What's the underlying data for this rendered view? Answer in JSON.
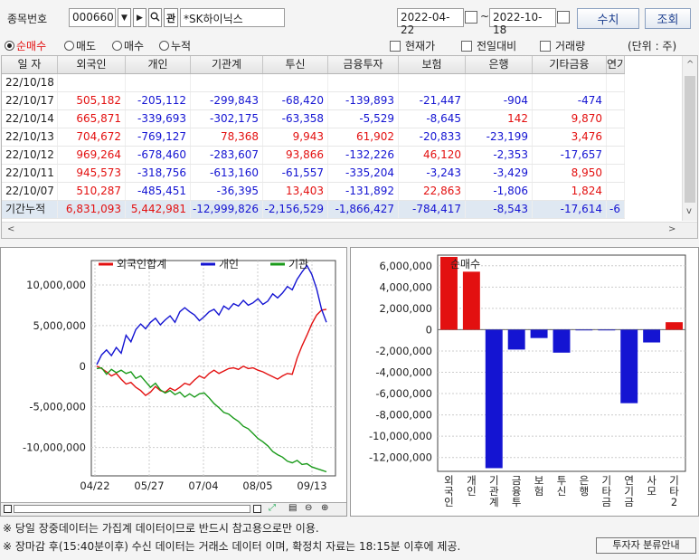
{
  "toolbar": {
    "code_label": "종목번호",
    "code_value": "000660",
    "dropdown_icon": "triangle-down",
    "next_icon": "triangle-right",
    "search_icon": "magnifier",
    "link_label": "관",
    "name_value": "*SK하이닉스",
    "start_date": "2022-04-22",
    "end_date": "2022-10-18",
    "tilde": "~",
    "chart_button": "수치",
    "query_button": "조회"
  },
  "options": {
    "radios": [
      {
        "label": "순매수",
        "selected": true
      },
      {
        "label": "매도",
        "selected": false
      },
      {
        "label": "매수",
        "selected": false
      },
      {
        "label": "누적",
        "selected": false
      }
    ],
    "checks": [
      "현재가",
      "전일대비",
      "거래량"
    ],
    "unit": "(단위 : 주)"
  },
  "table": {
    "columns": [
      "일 자",
      "외국인",
      "개인",
      "기관계",
      "투신",
      "금융투자",
      "보험",
      "은행",
      "기타금융",
      "연기"
    ],
    "rows": [
      {
        "date": "22/10/18",
        "values": [
          "",
          "",
          "",
          "",
          "",
          "",
          "",
          "",
          ""
        ]
      },
      {
        "date": "22/10/17",
        "values": [
          "505,182",
          "-205,112",
          "-299,843",
          "-68,420",
          "-139,893",
          "-21,447",
          "-904",
          "-474",
          ""
        ]
      },
      {
        "date": "22/10/14",
        "values": [
          "665,871",
          "-339,693",
          "-302,175",
          "-63,358",
          "-5,529",
          "-8,645",
          "142",
          "9,870",
          ""
        ]
      },
      {
        "date": "22/10/13",
        "values": [
          "704,672",
          "-769,127",
          "78,368",
          "9,943",
          "61,902",
          "-20,833",
          "-23,199",
          "3,476",
          ""
        ]
      },
      {
        "date": "22/10/12",
        "values": [
          "969,264",
          "-678,460",
          "-283,607",
          "93,866",
          "-132,226",
          "46,120",
          "-2,353",
          "-17,657",
          ""
        ]
      },
      {
        "date": "22/10/11",
        "values": [
          "945,573",
          "-318,756",
          "-613,160",
          "-61,557",
          "-335,204",
          "-3,243",
          "-3,429",
          "8,950",
          ""
        ]
      },
      {
        "date": "22/10/07",
        "values": [
          "510,287",
          "-485,451",
          "-36,395",
          "13,403",
          "-131,892",
          "22,863",
          "-1,806",
          "1,824",
          ""
        ]
      }
    ],
    "total": {
      "date": "기간누적",
      "values": [
        "6,831,093",
        "5,442,981",
        "-12,999,826",
        "-2,156,529",
        "-1,866,427",
        "-784,417",
        "-8,543",
        "-17,614",
        "-6"
      ]
    }
  },
  "colors": {
    "positive": "#e31010",
    "negative": "#1414d2",
    "foreign": "#e31010",
    "individual": "#1414d2",
    "institution": "#1a9a1a"
  },
  "chart_data": [
    {
      "type": "line",
      "legend": [
        "외국인합계",
        "개인",
        "기관"
      ],
      "x_ticks": [
        "04/22",
        "05/27",
        "07/04",
        "08/05",
        "09/13"
      ],
      "y_ticks": [
        "10,000,000",
        "5,000,000",
        "0",
        "-5,000,000",
        "-10,000,000"
      ],
      "ylim": [
        -13500000,
        13000000
      ],
      "series": [
        {
          "name": "외국인합계",
          "color": "#e31010",
          "values": [
            0,
            -300000,
            -700000,
            -1200000,
            -900000,
            -1600000,
            -2200000,
            -2000000,
            -2600000,
            -3000000,
            -3600000,
            -3200000,
            -2500000,
            -3000000,
            -3200000,
            -2700000,
            -3000000,
            -2600000,
            -2100000,
            -2300000,
            -1700000,
            -1200000,
            -1500000,
            -900000,
            -500000,
            -900000,
            -600000,
            -300000,
            -200000,
            -400000,
            0,
            -300000,
            -200000,
            -500000,
            -700000,
            -1000000,
            -1300000,
            -1600000,
            -1200000,
            -900000,
            -1000000,
            1000000,
            2500000,
            3800000,
            5200000,
            6300000,
            6900000,
            7000000
          ]
        },
        {
          "name": "개인",
          "color": "#1414d2",
          "values": [
            200000,
            1400000,
            2000000,
            1300000,
            2300000,
            1600000,
            3800000,
            3000000,
            4500000,
            5200000,
            4600000,
            5400000,
            5900000,
            5100000,
            5700000,
            6200000,
            5400000,
            6700000,
            7200000,
            6700000,
            6300000,
            5600000,
            6100000,
            6700000,
            7000000,
            6300000,
            7400000,
            7000000,
            7700000,
            7400000,
            8100000,
            7500000,
            7800000,
            8300000,
            7600000,
            8000000,
            8900000,
            8400000,
            9000000,
            9800000,
            9400000,
            10700000,
            11600000,
            12400000,
            11300000,
            9500000,
            7000000,
            5400000
          ]
        },
        {
          "name": "기관",
          "color": "#1a9a1a",
          "values": [
            -300000,
            -200000,
            -1000000,
            -400000,
            -800000,
            -500000,
            -900000,
            -700000,
            -1500000,
            -1200000,
            -1900000,
            -2600000,
            -2100000,
            -2900000,
            -3300000,
            -3000000,
            -3500000,
            -3200000,
            -3800000,
            -3400000,
            -3800000,
            -3400000,
            -3300000,
            -3900000,
            -4600000,
            -5100000,
            -5700000,
            -5900000,
            -6400000,
            -6800000,
            -7400000,
            -7700000,
            -8300000,
            -8900000,
            -9300000,
            -9800000,
            -10500000,
            -10900000,
            -11200000,
            -11700000,
            -11900000,
            -11600000,
            -12100000,
            -12000000,
            -12400000,
            -12600000,
            -12800000,
            -13000000
          ]
        }
      ]
    },
    {
      "type": "bar",
      "title": "순매수",
      "categories": [
        "외국인",
        "개인",
        "기관계",
        "금융투",
        "보험",
        "투신",
        "은행",
        "기타금",
        "연기금",
        "사모",
        "기타2"
      ],
      "values": [
        6831093,
        5442981,
        -12999826,
        -1866427,
        -784417,
        -2156529,
        -8543,
        -17614,
        -6900000,
        -1200000,
        700000
      ],
      "y_ticks": [
        "6,000,000",
        "4,000,000",
        "2,000,000",
        "0",
        "-2,000,000",
        "-4,000,000",
        "-6,000,000",
        "-8,000,000",
        "-10,000,000",
        "-12,000,000"
      ],
      "ylim": [
        -13300000,
        7000000
      ]
    }
  ],
  "footer": {
    "note1": "※ 당일 장중데이터는 가집계 데이터이므로 반드시 참고용으로만 이용.",
    "note2": "※ 장마감 후(15:40분이후) 수신 데이터는 거래소 데이터 이며, 확정치 자료는 18:15분 이후에 제공.",
    "guide_button": "투자자 분류안내"
  }
}
